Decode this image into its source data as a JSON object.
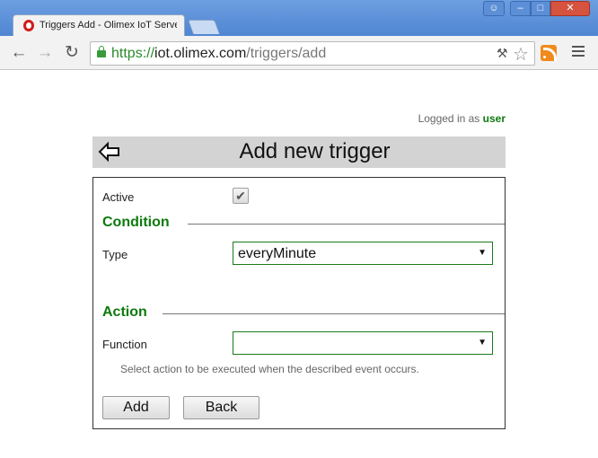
{
  "browser": {
    "tab_title": "Triggers Add - Olimex IoT Server",
    "url_scheme": "https://",
    "url_host": "iot.olimex.com",
    "url_path": "/triggers/add",
    "window_buttons": {
      "user": "☺",
      "minimize": "–",
      "maximize": "□",
      "close": "✕"
    },
    "icons": {
      "back": "←",
      "forward": "→",
      "reload": "↻",
      "key": "⚒",
      "star": "☆"
    }
  },
  "page": {
    "logged_prefix": "Logged in as",
    "logged_user": "user",
    "title": "Add new trigger"
  },
  "form": {
    "active_label": "Active",
    "active_checked": true,
    "active_mark": "✔",
    "condition_title": "Condition",
    "type_label": "Type",
    "type_value": "everyMinute",
    "action_title": "Action",
    "function_label": "Function",
    "function_value": "",
    "select_arrow": "▼",
    "hint": "Select action to be executed when the described event occurs.",
    "add_button": "Add",
    "back_button": "Back"
  },
  "colors": {
    "accent_green": "#0d7a0d",
    "header_bg": "#d3d3d3",
    "titlebar_blue": "#4f86d2"
  }
}
